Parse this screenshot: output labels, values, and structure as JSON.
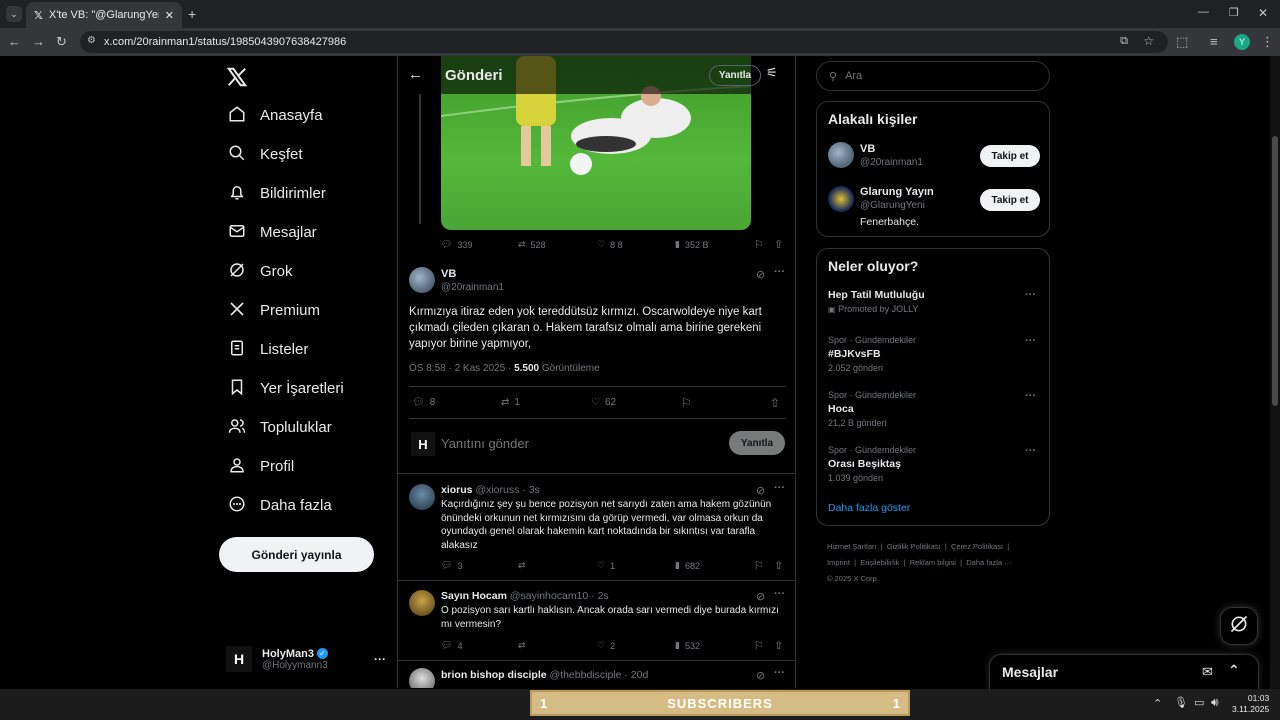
{
  "browser": {
    "tab_title": "X'te VB: \"@GlarungYeni Kırmızı",
    "url": "x.com/20rainman1/status/1985043907638427986"
  },
  "nav": {
    "items": [
      "Anasayfa",
      "Keşfet",
      "Bildirimler",
      "Mesajlar",
      "Grok",
      "Premium",
      "Listeler",
      "Yer İşaretleri",
      "Topluluklar",
      "Profil",
      "Daha fazla"
    ],
    "post_button": "Gönderi yayınla",
    "me_name": "HolyMan3",
    "me_handle": "@Holyymann3",
    "me_initial": "H"
  },
  "header": {
    "title": "Gönderi",
    "reply_button": "Yanıtla"
  },
  "quoted_actions": {
    "replies": "339",
    "reposts": "528",
    "likes": "8 8",
    "views": "352 B"
  },
  "main_post": {
    "name": "VB",
    "handle": "@20rainman1",
    "text": "Kırmızıya itiraz eden yok tereddütsüz kırmızı. Oscarwoldeye niye kart çıkmadı çileden çıkaran o. Hakem tarafsız olmalı ama birine gerekeni yapıyor birine yapmıyor,",
    "time": "ÖS 8:58 · 2 Kas 2025 · ",
    "views": "5.500",
    "views_label": " Görüntüleme",
    "replies": "8",
    "reposts": "1",
    "likes": "62"
  },
  "composer": {
    "placeholder": "Yanıtını gönder",
    "button": "Yanıtla",
    "avatar_initial": "H"
  },
  "replies": [
    {
      "name": "xiorus",
      "handle": "@xioruss",
      "time": "· 3s",
      "text": "Kaçırdığınız şey şu bence pozisyon net sarıydı zaten ama hakem gözünün önündeki orkunun net kırmızısını da görüp vermedi, var olmasa orkun da oyundaydı genel olarak hakemin kart noktadında bir sıkıntısı var tarafla alakasız",
      "replies": "3",
      "reposts": "",
      "likes": "1",
      "views": "682"
    },
    {
      "name": "Sayın Hocam",
      "handle": "@sayinhocam10",
      "time": "· 2s",
      "text": "O pozisyon sarı kartlı haklısın. Ancak orada sarı vermedi diye burada kırmızı mı vermesin?",
      "replies": "4",
      "reposts": "",
      "likes": "2",
      "views": "532"
    },
    {
      "name": "brion bishop disciple",
      "handle": "@thebbdisciple",
      "time": "· 20d",
      "text": "",
      "replies": "",
      "reposts": "",
      "likes": "",
      "views": ""
    }
  ],
  "search": {
    "placeholder": "Ara"
  },
  "people": {
    "title": "Alakalı kişiler",
    "items": [
      {
        "name": "VB",
        "handle": "@20rainman1",
        "bio": "",
        "button": "Takip et"
      },
      {
        "name": "Glarung Yayın",
        "handle": "@GlarungYeni",
        "bio": "Fenerbahçe.",
        "button": "Takip et"
      }
    ]
  },
  "trends": {
    "title": "Neler oluyor?",
    "items": [
      {
        "context": "",
        "name": "Hep Tatil Mutluluğu",
        "meta": "Promoted by JOLLY"
      },
      {
        "context": "Spor · Gündemdekiler",
        "name": "#BJKvsFB",
        "meta": "2.052 gönderi"
      },
      {
        "context": "Spor · Gündemdekiler",
        "name": "Hoca",
        "meta": "21,2 B gönderi"
      },
      {
        "context": "Spor · Gündemdekiler",
        "name": "Orası Beşiktaş",
        "meta": "1.039 gönderi"
      }
    ],
    "show_more": "Daha fazla göster"
  },
  "footer": {
    "line1": [
      "Hizmet Şartları",
      "Gizlilik Politikası",
      "Çerez Politikası"
    ],
    "line2": [
      "Imprint",
      "Erişilebilirlik",
      "Reklam bilgisi",
      "Daha fazla ···"
    ],
    "copyright": "© 2025 X Corp."
  },
  "messages_drawer": {
    "title": "Mesajlar"
  },
  "overlay": {
    "left": "1",
    "label": "SUBSCRIBERS",
    "right": "1"
  },
  "clock": {
    "time": "01:03",
    "date": "3.11.2025"
  }
}
